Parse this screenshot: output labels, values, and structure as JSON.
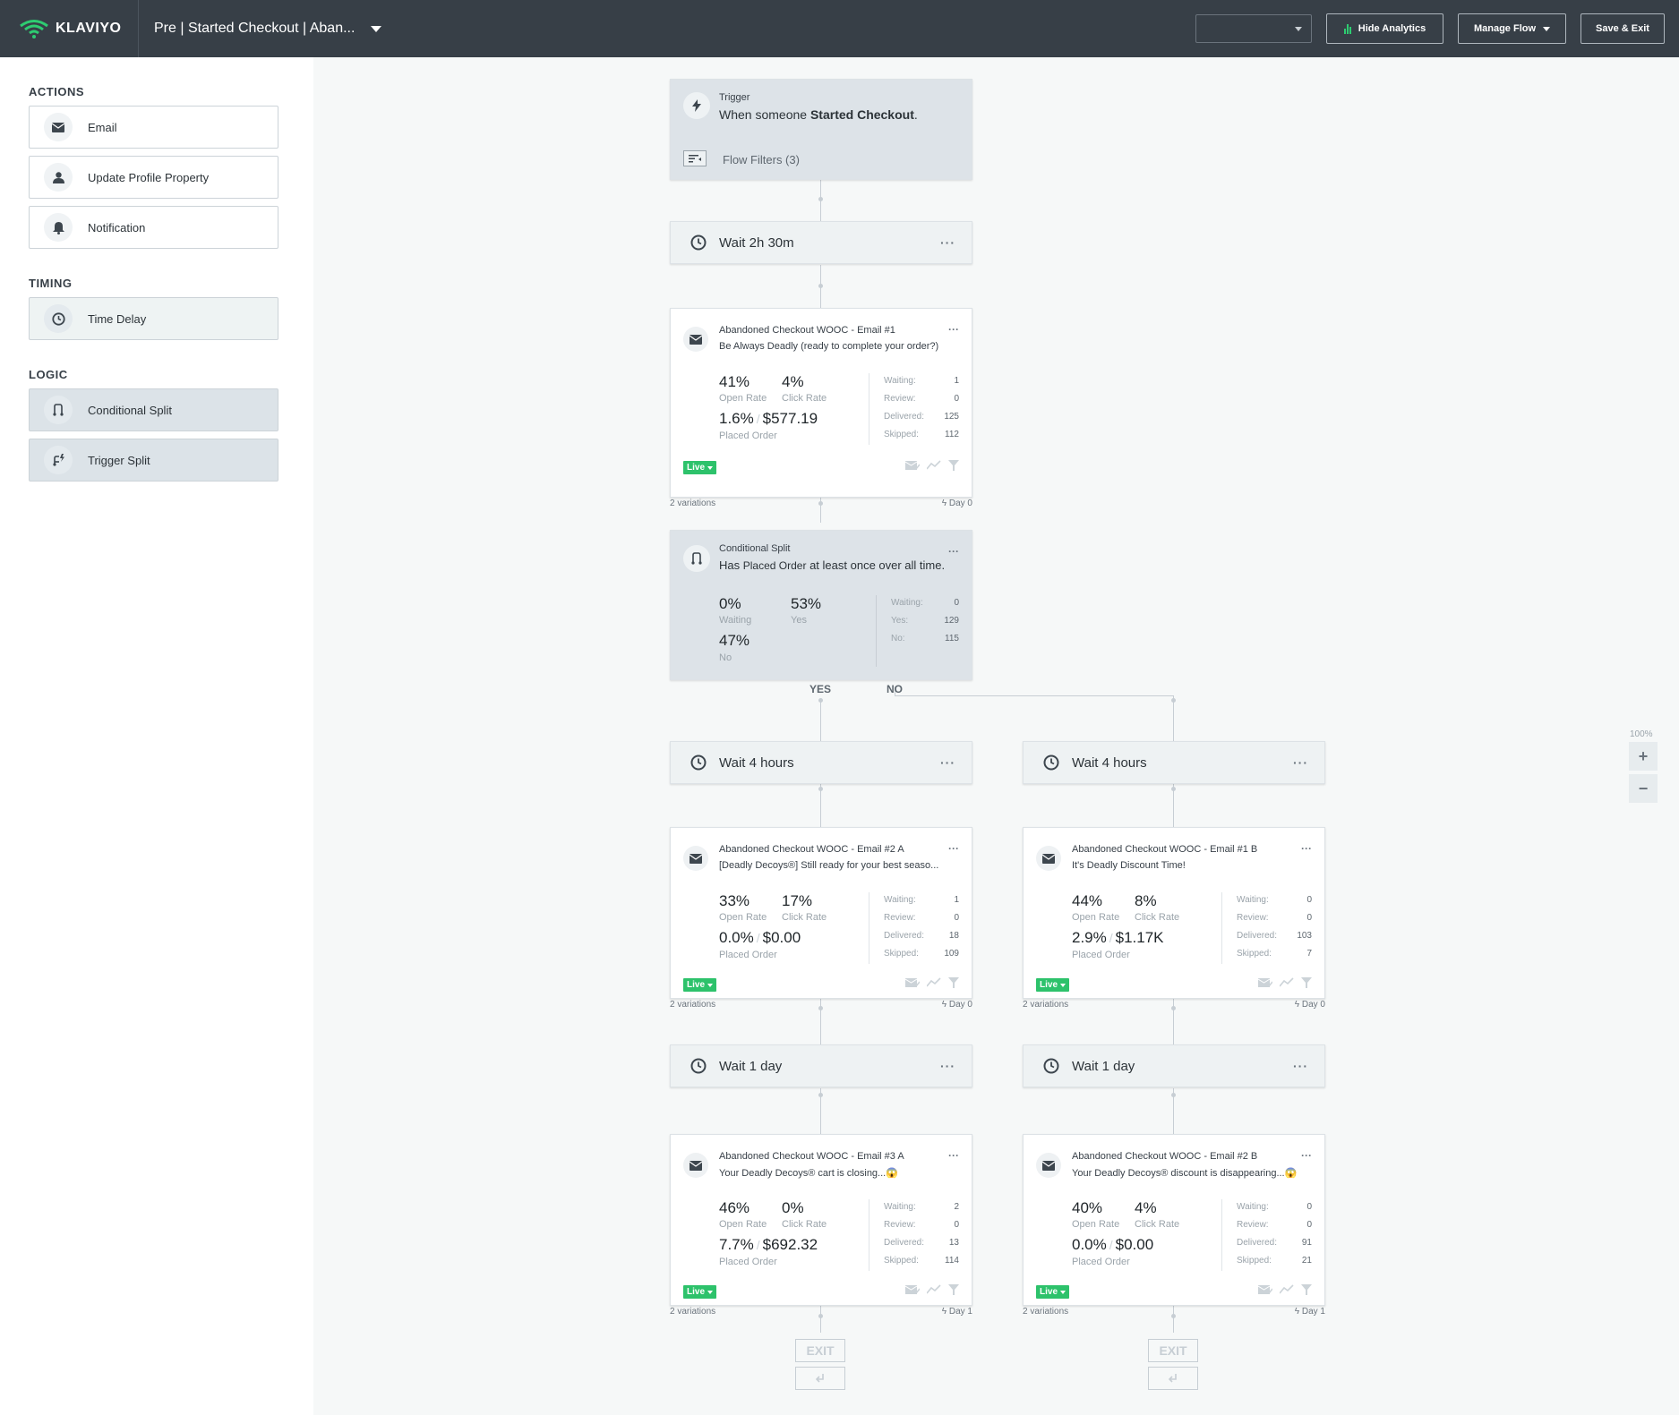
{
  "topbar": {
    "logo_text": "KLAVIYO",
    "flow_name": "Pre | Started Checkout | Aban...",
    "select_value": "",
    "hide_analytics_label": "Hide Analytics",
    "manage_flow_label": "Manage Flow",
    "save_exit_label": "Save & Exit",
    "accent_color": "#2ecc71"
  },
  "sidebar": {
    "actions_title": "ACTIONS",
    "actions": [
      {
        "label": "Email",
        "icon": "mail-icon"
      },
      {
        "label": "Update Profile Property",
        "icon": "person-icon"
      },
      {
        "label": "Notification",
        "icon": "bell-icon"
      }
    ],
    "timing_title": "TIMING",
    "timing": [
      {
        "label": "Time Delay",
        "icon": "clock-icon"
      }
    ],
    "logic_title": "LOGIC",
    "logic": [
      {
        "label": "Conditional Split",
        "icon": "split-icon"
      },
      {
        "label": "Trigger Split",
        "icon": "trigger-split-icon"
      }
    ]
  },
  "trigger": {
    "title": "Trigger",
    "text_prefix": "When someone",
    "event": "Started Checkout",
    "text_suffix": ".",
    "filters": "Flow Filters (3)"
  },
  "wait1": {
    "label": "Wait 2h 30m"
  },
  "email1": {
    "name": "Abandoned Checkout WOOC - Email #1",
    "subject": "Be Always Deadly (ready to complete your order?)",
    "open_rate": "41%",
    "click_rate": "4%",
    "placed_rate": "1.6%",
    "placed_value": "$577.19",
    "waiting": "1",
    "review": "0",
    "delivered": "125",
    "skipped": "112",
    "variations": "2 variations",
    "day": "Day 0"
  },
  "split": {
    "title": "Conditional Split",
    "text_prefix": "Has",
    "metric": "Placed Order",
    "text_suffix": "at least once over all time.",
    "waiting_pct": "0%",
    "yes_pct": "53%",
    "no_pct": "47%",
    "waiting": "0",
    "yes": "129",
    "no": "115",
    "yes_label": "YES",
    "no_label": "NO"
  },
  "labels": {
    "open_rate": "Open Rate",
    "click_rate": "Click Rate",
    "placed_order": "Placed Order",
    "waiting": "Waiting:",
    "review": "Review:",
    "delivered": "Delivered:",
    "skipped": "Skipped:",
    "live": "Live",
    "waiting_word": "Waiting",
    "yes_word": "Yes",
    "no_word": "No",
    "yes_stat": "Yes:",
    "no_stat": "No:",
    "exit": "EXIT",
    "zoom": "100%"
  },
  "left": {
    "wait_a": {
      "label": "Wait 4 hours"
    },
    "email_a": {
      "name": "Abandoned Checkout WOOC - Email #2 A",
      "subject": "[Deadly Decoys®] Still ready for your best seaso...",
      "open_rate": "33%",
      "click_rate": "17%",
      "placed_rate": "0.0%",
      "placed_value": "$0.00",
      "waiting": "1",
      "review": "0",
      "delivered": "18",
      "skipped": "109",
      "variations": "2 variations",
      "day": "Day 0"
    },
    "wait_b": {
      "label": "Wait 1 day"
    },
    "email_b": {
      "name": "Abandoned Checkout WOOC - Email #3 A",
      "subject": "Your Deadly Decoys® cart is closing...😱",
      "open_rate": "46%",
      "click_rate": "0%",
      "placed_rate": "7.7%",
      "placed_value": "$692.32",
      "waiting": "2",
      "review": "0",
      "delivered": "13",
      "skipped": "114",
      "variations": "2 variations",
      "day": "Day 1"
    }
  },
  "right": {
    "wait_a": {
      "label": "Wait 4 hours"
    },
    "email_a": {
      "name": "Abandoned Checkout WOOC - Email #1 B",
      "subject": "It's Deadly Discount Time!",
      "open_rate": "44%",
      "click_rate": "8%",
      "placed_rate": "2.9%",
      "placed_value": "$1.17K",
      "waiting": "0",
      "review": "0",
      "delivered": "103",
      "skipped": "7",
      "variations": "2 variations",
      "day": "Day 0"
    },
    "wait_b": {
      "label": "Wait 1 day"
    },
    "email_b": {
      "name": "Abandoned Checkout WOOC - Email #2 B",
      "subject": "Your Deadly Decoys® discount is disappearing...😱",
      "open_rate": "40%",
      "click_rate": "4%",
      "placed_rate": "0.0%",
      "placed_value": "$0.00",
      "waiting": "0",
      "review": "0",
      "delivered": "91",
      "skipped": "21",
      "variations": "2 variations",
      "day": "Day 1"
    }
  }
}
